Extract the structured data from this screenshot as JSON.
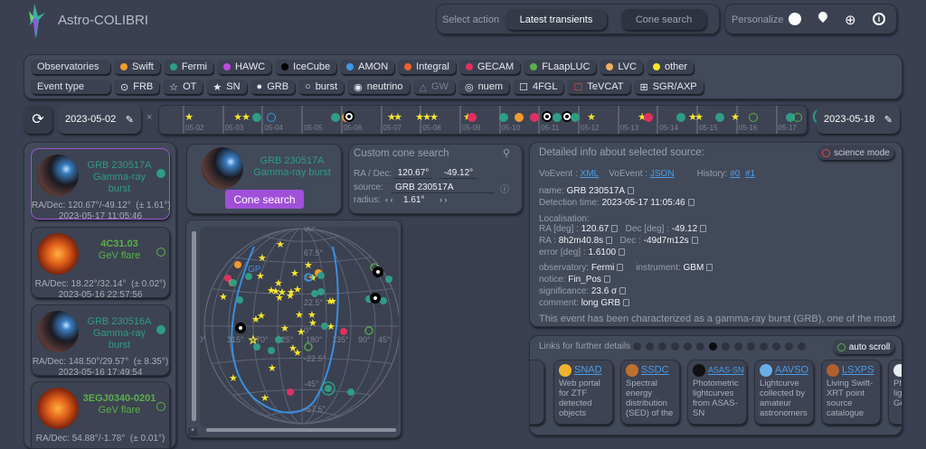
{
  "header": {
    "title": "Astro-COLIBRI",
    "select_action": "Select action",
    "latest": "Latest transients",
    "cone": "Cone search",
    "personalize": "Personalize"
  },
  "filters": {
    "observatories_label": "Observatories",
    "observatories": [
      {
        "label": "Swift",
        "color": "#f39a2e"
      },
      {
        "label": "Fermi",
        "color": "#2f9c86"
      },
      {
        "label": "HAWC",
        "color": "#c049e0"
      },
      {
        "label": "IceCube",
        "color": "#000000"
      },
      {
        "label": "AMON",
        "color": "#3a9ae8"
      },
      {
        "label": "Integral",
        "color": "#f06030"
      },
      {
        "label": "GECAM",
        "color": "#e03060"
      },
      {
        "label": "FLaapLUC",
        "color": "#5ab04a"
      },
      {
        "label": "LVC",
        "color": "#f0b060"
      },
      {
        "label": "other",
        "color": "#f6e62e"
      }
    ],
    "event_type_label": "Event type",
    "event_types": [
      {
        "icon": "⊙",
        "label": "FRB"
      },
      {
        "icon": "☆",
        "label": "OT"
      },
      {
        "icon": "★",
        "label": "SN"
      },
      {
        "icon": "●",
        "label": "GRB"
      },
      {
        "icon": "○",
        "label": "burst"
      },
      {
        "icon": "◉",
        "label": "neutrino"
      },
      {
        "icon": "△",
        "label": "GW"
      },
      {
        "icon": "◎",
        "label": "nuem"
      },
      {
        "icon": "☐",
        "label": "4FGL"
      },
      {
        "icon": "☐",
        "label": "TeVCAT"
      },
      {
        "icon": "⊞",
        "label": "SGR/AXP"
      }
    ]
  },
  "timeline": {
    "start": "2023-05-02",
    "end": "2023-05-18",
    "sep": "×",
    "days": [
      "05-02",
      "05-03",
      "05-04",
      "05-05",
      "05-06",
      "05-07",
      "05-08",
      "05-09",
      "05-10",
      "05-11",
      "05-12",
      "05-13",
      "05-14",
      "05-15",
      "05-16",
      "05-17"
    ]
  },
  "events": [
    {
      "name": "GRB 230517A",
      "type": "Gamma-ray burst",
      "radec": "RA/Dec: 120.67°/-49.12°  (± 1.61°)",
      "time": "2023-05-17 11:05:46",
      "color": "#2f9c86"
    },
    {
      "name": "4C31.03",
      "type": "GeV flare",
      "radec": "RA/Dec: 18.22°/32.14°  (± 0.02°)",
      "time": "2023-05-16 22:57:56",
      "color": "#5ab04a"
    },
    {
      "name": "GRB 230516A",
      "type": "Gamma-ray burst",
      "radec": "RA/Dec: 148.50°/29.57°  (± 8.35°)",
      "time": "2023-05-16 17:49:54",
      "color": "#2f9c86"
    },
    {
      "name": "3EGJ0340-0201",
      "type": "GeV flare",
      "radec": "RA/Dec: 54.88°/-1.78°  (± 0.01°)",
      "time": "",
      "color": "#5ab04a"
    }
  ],
  "selected": {
    "name": "GRB 230517A",
    "type": "Gamma-ray burst",
    "button": "Cone search"
  },
  "cone": {
    "title": "Custom cone search",
    "radec_label": "RA / Dec:",
    "ra": "120.67°",
    "dec": "-49.12°",
    "source_label": "source:",
    "source": "GRB 230517A",
    "radius_label": "radius:",
    "radius": "1.61°"
  },
  "skymap": {
    "dec_labels": [
      "90°",
      "67.5°",
      "45°",
      "22.5°",
      "0°",
      "-22.5°",
      "-45°",
      "-67.5°"
    ],
    "ra_labels": [
      "0°",
      "315°",
      "270°",
      "225°",
      "180°",
      "135°",
      "90°",
      "45°"
    ],
    "gp": "GP"
  },
  "detail": {
    "title": "Detailed info about selected source:",
    "science": "science mode",
    "vo1": "VoEvent :",
    "xml": "XML",
    "vo2": "VoEvent :",
    "json": "JSON",
    "history": "History:",
    "h0": "#0",
    "h1": "#1",
    "name_l": "name:",
    "name": "GRB 230517A",
    "det_l": "Detection time:",
    "det": "2023-05-17 11:05:46",
    "loc": "Localisation:",
    "ra_l": "RA [deg] :",
    "ra": "120.67",
    "dec_l": "Dec [deg] :",
    "dec": "-49.12",
    "ras_l": "RA :",
    "ras": "8h2m40.8s",
    "decs_l": "Dec :",
    "decs": "-49d7m12s",
    "err_l": "error [deg] :",
    "err": "1.6100",
    "obs_l": "observatory:",
    "obs": "Fermi",
    "inst_l": "instrument:",
    "inst": "GBM",
    "notice_l": "notice:",
    "notice": "Fin_Pos",
    "sig_l": "significance:",
    "sig": "23.6 σ",
    "comment_l": "comment:",
    "comment": "long GRB",
    "desc": "This event has been characterized as a gamma-ray burst (GRB), one of the most"
  },
  "links": {
    "title": "Links for further details",
    "auto": "auto scroll",
    "active_page": 7,
    "pages": 14,
    "items": [
      {
        "name": "SNAD",
        "desc": "Web portal for ZTF detected objects",
        "color": "#f0b030"
      },
      {
        "name": "SSDC",
        "desc": "Spectral energy distribution (SED) of the",
        "color": "#c07030"
      },
      {
        "name": "ASAS-SN",
        "desc": "Photometric lightcurves from ASAS-SN",
        "color": "#111111"
      },
      {
        "name": "AAVSO",
        "desc": "Lightcurve collected by amateur astronomers",
        "color": "#6aaee8"
      },
      {
        "name": "LSXPS",
        "desc": "Living Swift-XRT point source catalogue",
        "color": "#b06030"
      },
      {
        "name": "",
        "desc": "Photometric lightcurves Ge rec",
        "color": "#e8eef4"
      }
    ]
  }
}
